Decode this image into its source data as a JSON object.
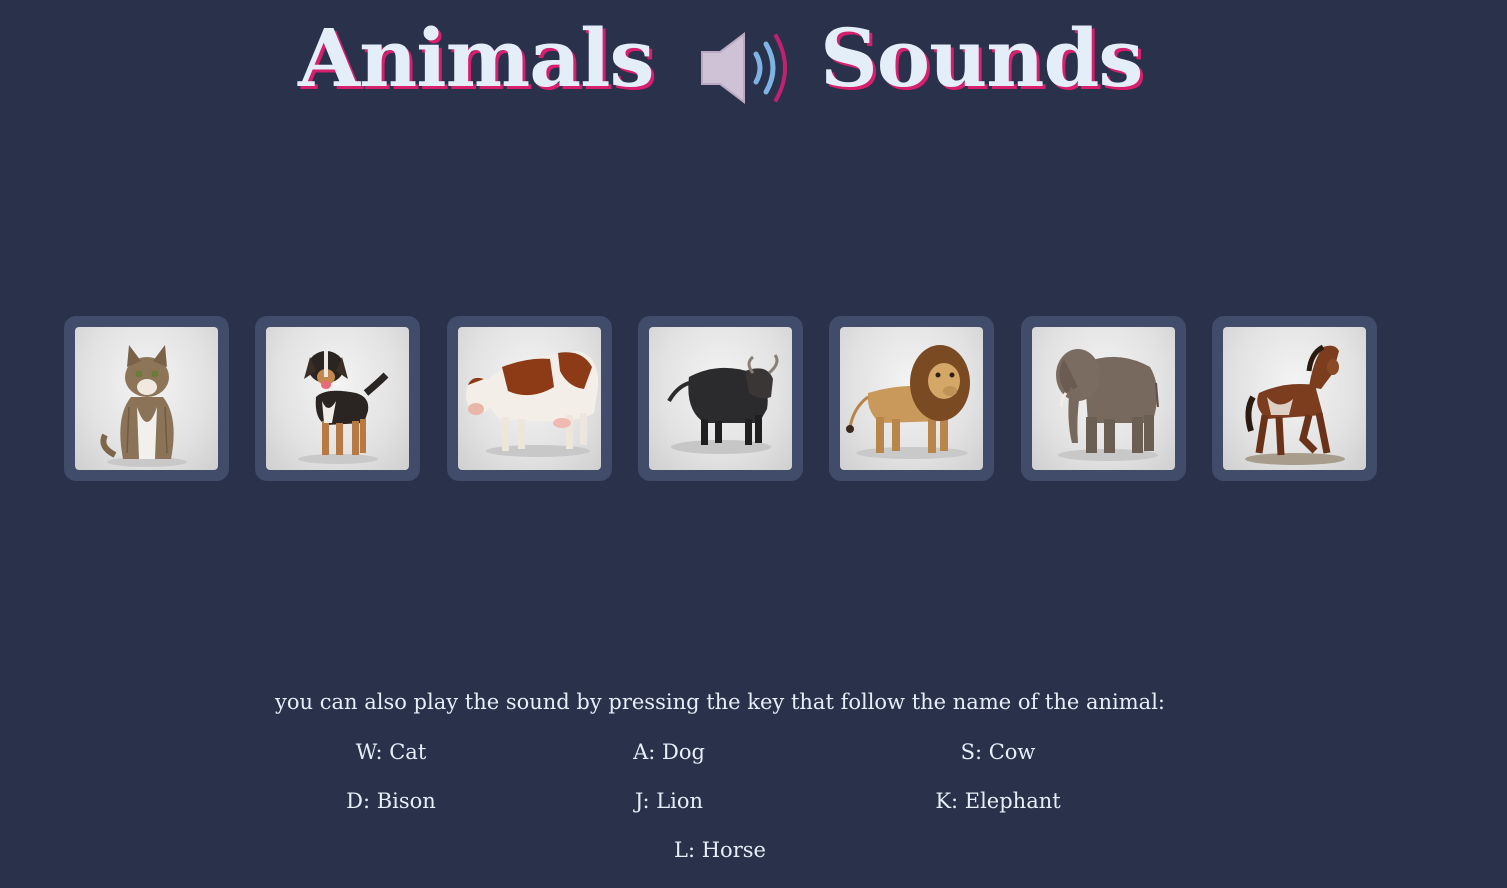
{
  "title": {
    "word1": "Animals",
    "word2": "Sounds",
    "icon": "speaker-icon"
  },
  "colors": {
    "background": "#29314b",
    "card": "#414b6a",
    "title_text": "#e3eef8",
    "title_shadow": "#d6206e"
  },
  "animals": [
    {
      "name": "Cat",
      "key": "W",
      "icon": "cat-photo"
    },
    {
      "name": "Dog",
      "key": "A",
      "icon": "dog-photo"
    },
    {
      "name": "Cow",
      "key": "S",
      "icon": "cow-photo"
    },
    {
      "name": "Bison",
      "key": "D",
      "icon": "bison-photo"
    },
    {
      "name": "Lion",
      "key": "J",
      "icon": "lion-photo"
    },
    {
      "name": "Elephant",
      "key": "K",
      "icon": "elephant-photo"
    },
    {
      "name": "Horse",
      "key": "L",
      "icon": "horse-photo"
    }
  ],
  "instructions": {
    "text": "you can also play the sound by pressing the key that follow the name of the animal:",
    "keys": [
      "W: Cat",
      "A: Dog",
      "S: Cow",
      "D: Bison",
      "J: Lion",
      "K: Elephant",
      "L: Horse"
    ]
  }
}
